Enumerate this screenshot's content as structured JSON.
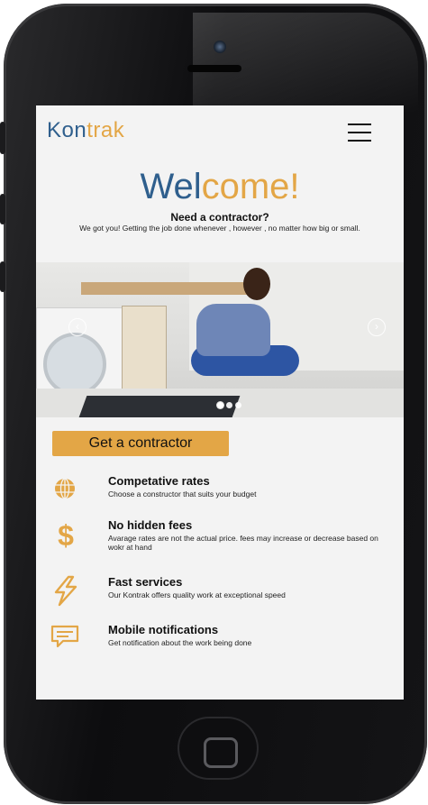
{
  "brand": {
    "part1": "Kon",
    "part2": "trak"
  },
  "hero": {
    "welcome_part1": "Wel",
    "welcome_part2": "come!",
    "question": "Need a contractor?",
    "subtitle": "We got you! Getting the job done whenever , however , no matter how big or small."
  },
  "carousel": {
    "prev_glyph": "‹",
    "next_glyph": "›",
    "slide_count": 3,
    "active_slide": 1
  },
  "cta": {
    "label": "Get a contractor"
  },
  "features": [
    {
      "icon": "globe-icon",
      "title": "Competative rates",
      "desc": "Choose a constructor that suits your budget"
    },
    {
      "icon": "dollar-icon",
      "title": "No hidden fees",
      "desc": "Avarage rates are not  the actual price. fees may increase or decrease based on wokr at hand"
    },
    {
      "icon": "lightning-icon",
      "title": "Fast services",
      "desc": "Our Kontrak offers quality work at exceptional speed"
    },
    {
      "icon": "message-icon",
      "title": "Mobile notifications",
      "desc": "Get notification about the work being done"
    }
  ],
  "colors": {
    "primary_blue": "#2f5f8d",
    "accent_orange": "#e3a646",
    "screen_bg": "#f3f3f3"
  }
}
